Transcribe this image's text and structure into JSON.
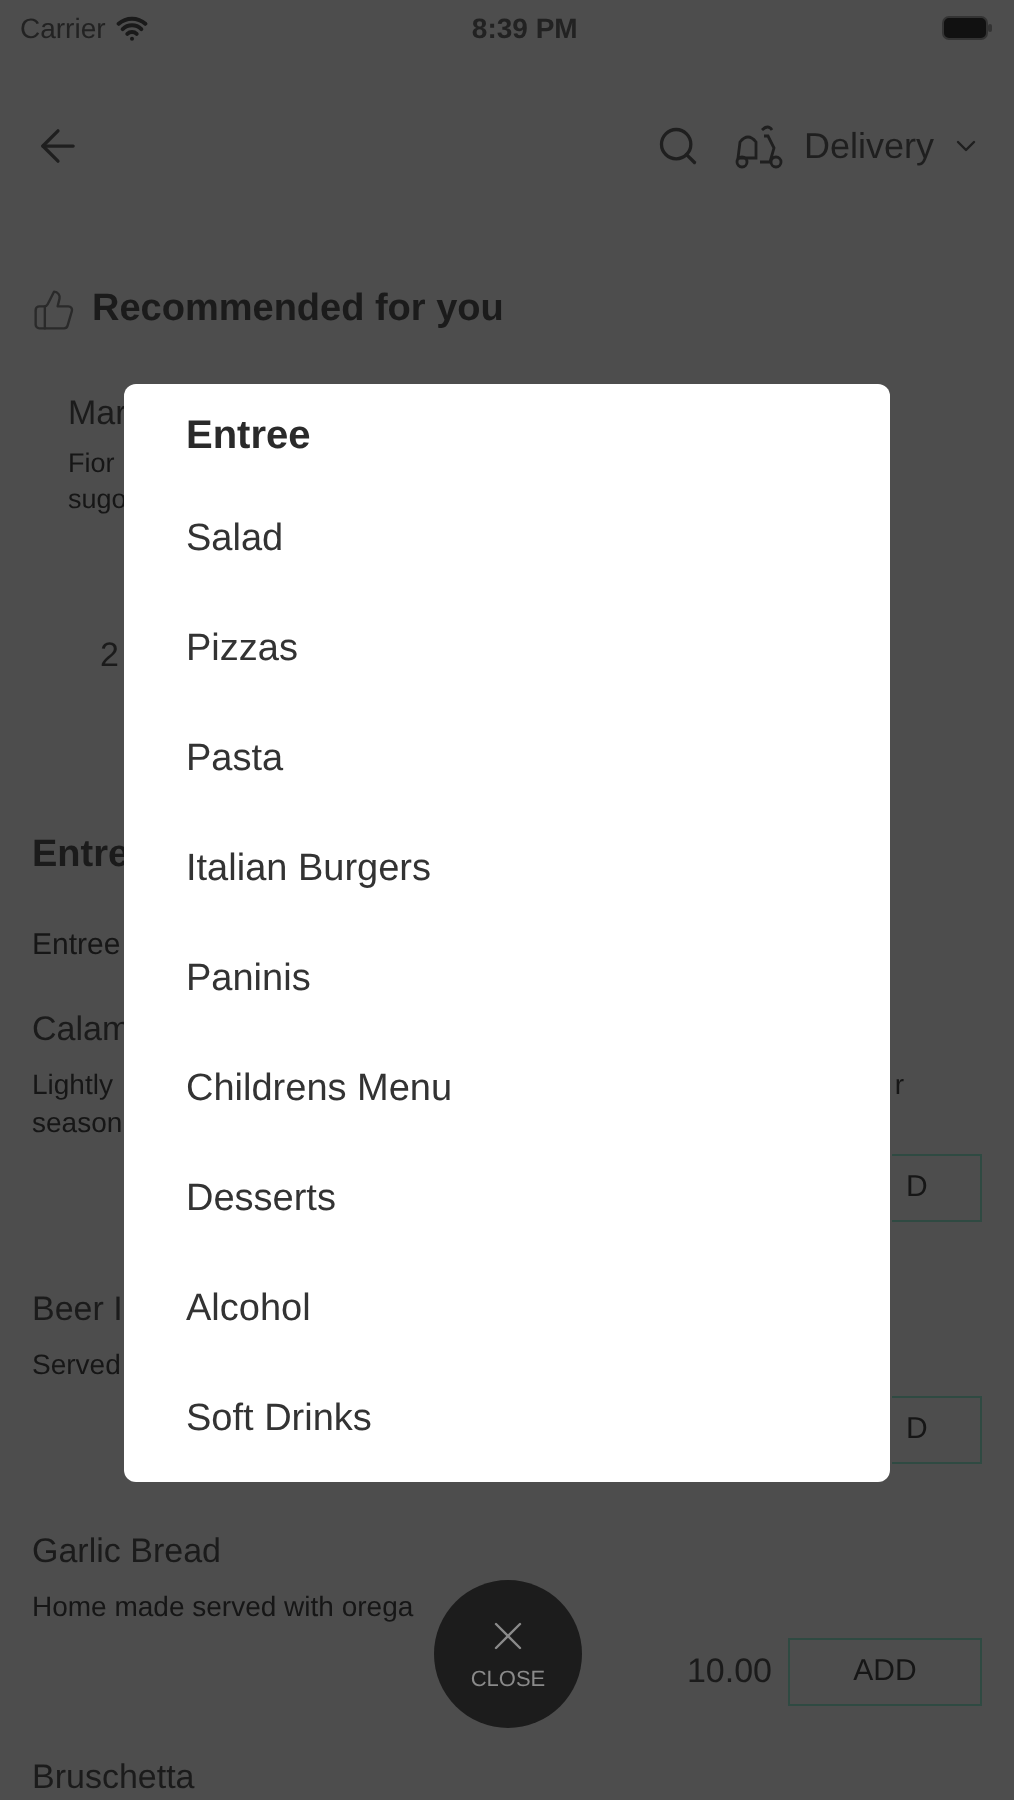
{
  "status_bar": {
    "carrier": "Carrier",
    "time": "8:39 PM"
  },
  "nav": {
    "delivery_label": "Delivery"
  },
  "recommended": {
    "title": "Recommended for you",
    "item": {
      "name": "Mar",
      "description": [
        "Fior",
        "sugo"
      ],
      "price": "2"
    }
  },
  "section": {
    "title": "Entre",
    "subtitle": "Entree"
  },
  "items": [
    {
      "name": "Calam",
      "description": [
        "Lightly",
        "season"
      ],
      "description_right": "r",
      "add_label": "D"
    },
    {
      "name": "Beer I",
      "description": [
        "Served"
      ],
      "add_label": "D"
    },
    {
      "name": "Garlic Bread",
      "description": [
        "Home made served with orega"
      ],
      "price": "10.00",
      "add_label": "ADD"
    },
    {
      "name": "Bruschetta"
    }
  ],
  "menu": {
    "title": "Entree",
    "items": [
      {
        "label": "Salad"
      },
      {
        "label": "Pizzas"
      },
      {
        "label": "Pasta"
      },
      {
        "label": "Italian Burgers"
      },
      {
        "label": "Paninis"
      },
      {
        "label": "Childrens Menu"
      },
      {
        "label": "Desserts"
      },
      {
        "label": "Alcohol"
      },
      {
        "label": "Soft Drinks"
      }
    ]
  },
  "close_button": {
    "label": "CLOSE"
  }
}
